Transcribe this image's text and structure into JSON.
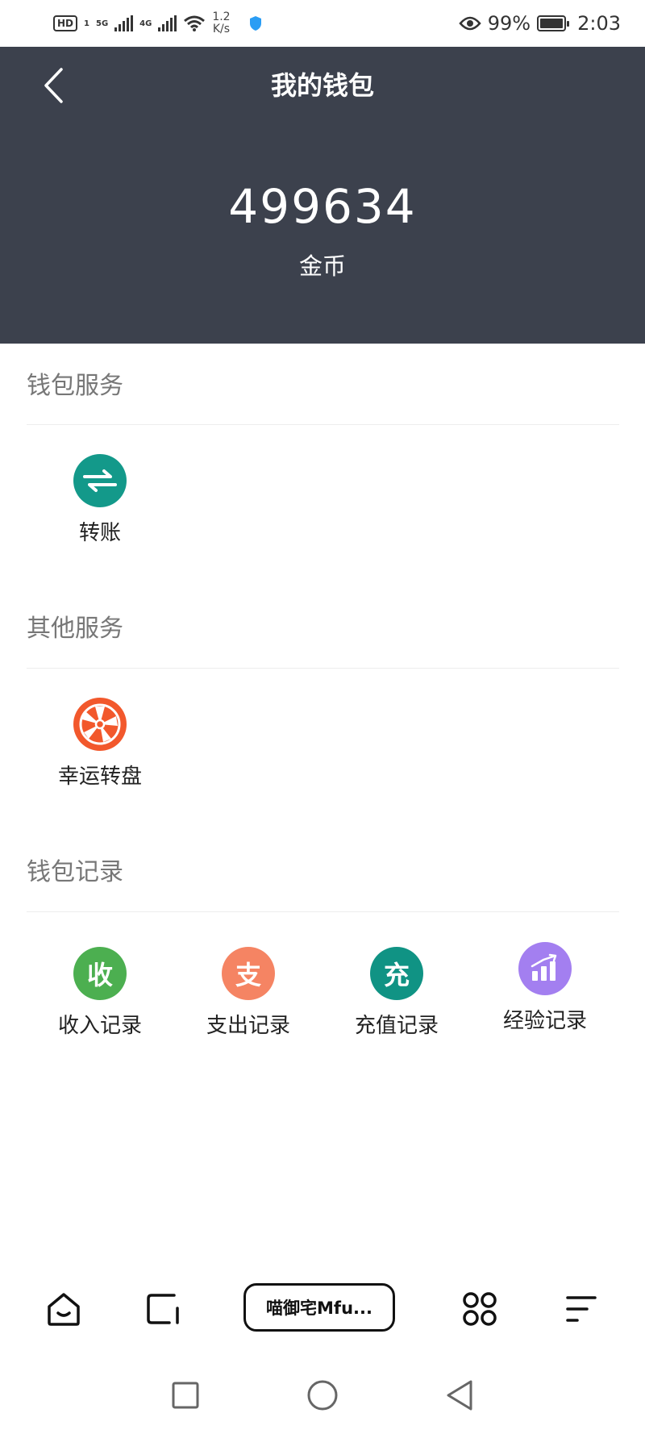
{
  "status_bar": {
    "hd": "HD",
    "sim1": "1",
    "net1": "5G",
    "net2": "4G",
    "speed_value": "1.2",
    "speed_unit": "K/s",
    "battery_percent": "99%",
    "time": "2:03"
  },
  "header": {
    "title": "我的钱包",
    "balance": "499634",
    "currency": "金币"
  },
  "sections": {
    "wallet_service": {
      "title": "钱包服务",
      "items": [
        {
          "label": "转账",
          "icon": "transfer-icon",
          "color": "#13998a"
        }
      ]
    },
    "other_service": {
      "title": "其他服务",
      "items": [
        {
          "label": "幸运转盘",
          "icon": "lucky-wheel-icon",
          "color": "#f2582c"
        }
      ]
    },
    "wallet_records": {
      "title": "钱包记录",
      "items": [
        {
          "label": "收入记录",
          "glyph": "收",
          "color": "#4caf50"
        },
        {
          "label": "支出记录",
          "glyph": "支",
          "color": "#f58463"
        },
        {
          "label": "充值记录",
          "glyph": "充",
          "color": "#109384"
        },
        {
          "label": "经验记录",
          "icon": "chart-icon",
          "color": "#a37ff0"
        }
      ]
    }
  },
  "bottom_nav": {
    "pill_label": "喵御宅Mfu..."
  }
}
